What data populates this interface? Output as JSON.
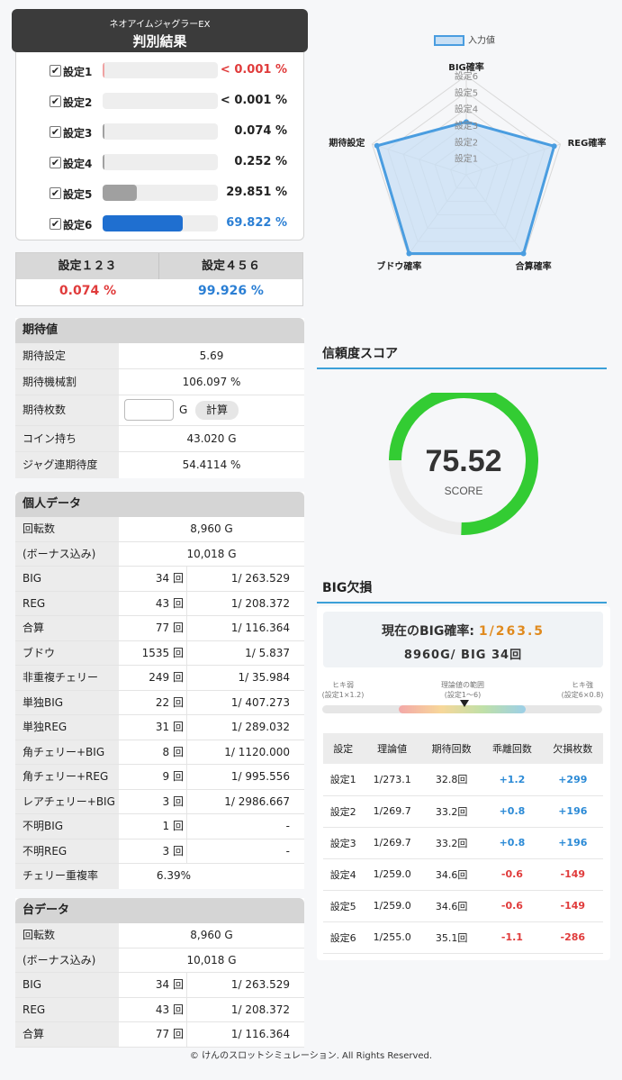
{
  "header": {
    "machine": "ネオアイムジャグラーEX",
    "title": "判別結果"
  },
  "settings": [
    {
      "label": "設定1",
      "pct": "< 0.001 %",
      "fill": 0.0,
      "color": "#e03b3b",
      "check": "✔"
    },
    {
      "label": "設定2",
      "pct": "< 0.001 %",
      "fill": 0.0,
      "color": "#222222",
      "check": "✔"
    },
    {
      "label": "設定3",
      "pct": "0.074 %",
      "fill": 0.00074,
      "color": "#222222",
      "check": "✔"
    },
    {
      "label": "設定4",
      "pct": "0.252 %",
      "fill": 0.00252,
      "color": "#222222",
      "check": "✔"
    },
    {
      "label": "設定5",
      "pct": "29.851 %",
      "fill": 0.29851,
      "color": "#222222",
      "check": "✔"
    },
    {
      "label": "設定6",
      "pct": "69.822 %",
      "fill": 0.69822,
      "color": "#2b7fd4",
      "check": "✔"
    }
  ],
  "summary": {
    "low_label": "設定１２３",
    "low_value": "0.074 %",
    "high_label": "設定４５６",
    "high_value": "99.926 %"
  },
  "expected": {
    "title": "期待値",
    "setting_label": "期待設定",
    "setting_value": "5.69",
    "payout_label": "期待機械割",
    "payout_value": "106.097 %",
    "coins_label": "期待枚数",
    "coins_unit": "G",
    "calc_button": "計算",
    "holding_label": "コイン持ち",
    "holding_value": "43.020 G",
    "streak_label": "ジャグ連期待度",
    "streak_value": "54.4114 %"
  },
  "personal": {
    "title": "個人データ",
    "games_label": "回転数",
    "games_value": "8,960 G",
    "bonus_games_label": "(ボーナス込み)",
    "bonus_games_value": "10,018 G",
    "rows": [
      {
        "label": "BIG",
        "count": "34 回",
        "rate": "1/ 263.529"
      },
      {
        "label": "REG",
        "count": "43 回",
        "rate": "1/ 208.372"
      },
      {
        "label": "合算",
        "count": "77 回",
        "rate": "1/ 116.364"
      },
      {
        "label": "ブドウ",
        "count": "1535 回",
        "rate": "1/ 5.837"
      },
      {
        "label": "非重複チェリー",
        "count": "249 回",
        "rate": "1/ 35.984"
      },
      {
        "label": "単独BIG",
        "count": "22 回",
        "rate": "1/ 407.273"
      },
      {
        "label": "単独REG",
        "count": "31 回",
        "rate": "1/ 289.032"
      },
      {
        "label": "角チェリー+BIG",
        "count": "8 回",
        "rate": "1/ 1120.000"
      },
      {
        "label": "角チェリー+REG",
        "count": "9 回",
        "rate": "1/ 995.556"
      },
      {
        "label": "レアチェリー+BIG",
        "count": "3 回",
        "rate": "1/ 2986.667"
      },
      {
        "label": "不明BIG",
        "count": "1 回",
        "rate": "-"
      },
      {
        "label": "不明REG",
        "count": "3 回",
        "rate": "-"
      }
    ],
    "cherry_label": "チェリー重複率",
    "cherry_value": "6.39%"
  },
  "machine": {
    "title": "台データ",
    "games_label": "回転数",
    "games_value": "8,960 G",
    "bonus_games_label": "(ボーナス込み)",
    "bonus_games_value": "10,018 G",
    "rows": [
      {
        "label": "BIG",
        "count": "34 回",
        "rate": "1/ 263.529"
      },
      {
        "label": "REG",
        "count": "43 回",
        "rate": "1/ 208.372"
      },
      {
        "label": "合算",
        "count": "77 回",
        "rate": "1/ 116.364"
      }
    ]
  },
  "radar": {
    "legend": "入力値",
    "axes": [
      "BIG確率",
      "REG確率",
      "合算確率",
      "ブドウ確率",
      "期待設定"
    ],
    "ring_labels": [
      "設定1",
      "設定2",
      "設定3",
      "設定4",
      "設定5",
      "設定6"
    ],
    "values": [
      3.2,
      5.6,
      5.9,
      5.9,
      5.69
    ],
    "max": 6,
    "fill_color": "#c8dff4",
    "line_color": "#4a9de0"
  },
  "score": {
    "title": "信頼度スコア",
    "value": "75.52",
    "label": "SCORE",
    "ratio": 0.7552,
    "color": "#33cc33"
  },
  "big_miss": {
    "title": "BIG欠損",
    "current_label": "現在のBIG確率:",
    "current_value": "1/263.5",
    "detail": "8960G/ BIG 34回",
    "weak_label": "ヒキ弱",
    "weak_sub": "(設定1×1.2)",
    "range_label": "理論値の範囲",
    "range_sub": "(設定1～6)",
    "strong_label": "ヒキ強",
    "strong_sub": "(設定6×0.8)",
    "headers": [
      "設定",
      "理論値",
      "期待回数",
      "乖離回数",
      "欠損枚数"
    ],
    "rows": [
      {
        "set": "設定1",
        "theory": "1/273.1",
        "expect": "32.8回",
        "diff": "+1.2",
        "loss": "+299",
        "sign": "pos"
      },
      {
        "set": "設定2",
        "theory": "1/269.7",
        "expect": "33.2回",
        "diff": "+0.8",
        "loss": "+196",
        "sign": "pos"
      },
      {
        "set": "設定3",
        "theory": "1/269.7",
        "expect": "33.2回",
        "diff": "+0.8",
        "loss": "+196",
        "sign": "pos"
      },
      {
        "set": "設定4",
        "theory": "1/259.0",
        "expect": "34.6回",
        "diff": "-0.6",
        "loss": "-149",
        "sign": "neg"
      },
      {
        "set": "設定5",
        "theory": "1/259.0",
        "expect": "34.6回",
        "diff": "-0.6",
        "loss": "-149",
        "sign": "neg"
      },
      {
        "set": "設定6",
        "theory": "1/255.0",
        "expect": "35.1回",
        "diff": "-1.1",
        "loss": "-286",
        "sign": "neg"
      }
    ]
  },
  "footer": "© けんのスロットシミュレーション. All Rights Reserved."
}
